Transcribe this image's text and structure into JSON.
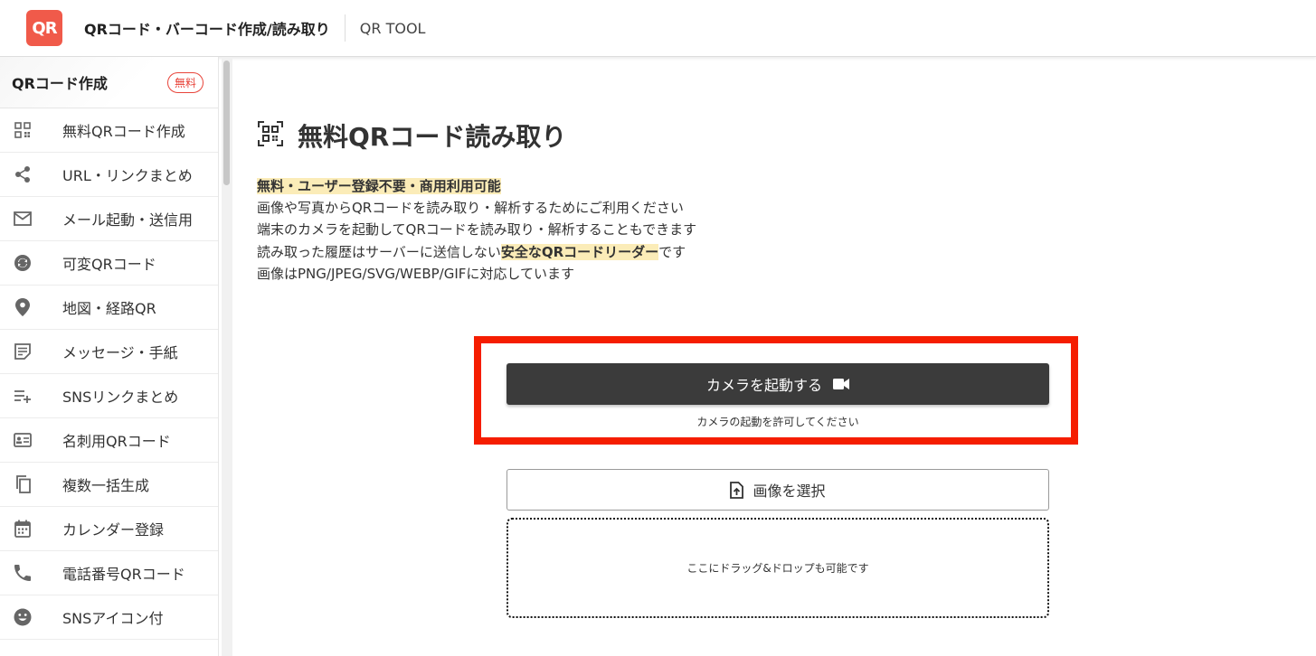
{
  "header": {
    "logo_text": "QR",
    "site_title": "QRコード・バーコード作成/読み取り",
    "sub_title": "QR TOOL"
  },
  "sidebar": {
    "heading": "QRコード作成",
    "badge": "無料",
    "items": [
      {
        "label": "無料QRコード作成",
        "icon": "qr-grid-icon"
      },
      {
        "label": "URL・リンクまとめ",
        "icon": "share-icon"
      },
      {
        "label": "メール起動・送信用",
        "icon": "mail-icon"
      },
      {
        "label": "可変QRコード",
        "icon": "sync-icon"
      },
      {
        "label": "地図・経路QR",
        "icon": "map-pin-icon"
      },
      {
        "label": "メッセージ・手紙",
        "icon": "note-icon"
      },
      {
        "label": "SNSリンクまとめ",
        "icon": "playlist-add-icon"
      },
      {
        "label": "名刺用QRコード",
        "icon": "id-card-icon"
      },
      {
        "label": "複数一括生成",
        "icon": "copy-icon"
      },
      {
        "label": "カレンダー登録",
        "icon": "calendar-icon"
      },
      {
        "label": "電話番号QRコード",
        "icon": "phone-icon"
      },
      {
        "label": "SNSアイコン付",
        "icon": "smiley-icon"
      }
    ]
  },
  "main": {
    "title": "無料QRコード読み取り",
    "desc": {
      "line1": "無料・ユーザー登録不要・商用利用可能",
      "line2": "画像や写真からQRコードを読み取り・解析するためにご利用ください",
      "line3": "端末のカメラを起動してQRコードを読み取り・解析することもできます",
      "line4_pre": "読み取った履歴はサーバーに送信しない",
      "line4_hl": "安全なQRコードリーダー",
      "line4_post": "です",
      "line5": "画像はPNG/JPEG/SVG/WEBP/GIFに対応しています"
    },
    "camera_button": "カメラを起動する",
    "camera_note": "カメラの起動を許可してください",
    "select_button": "画像を選択",
    "drop_text": "ここにドラッグ&ドロップも可能です"
  },
  "colors": {
    "accent_red": "#f51d00",
    "logo": "#f05a4a",
    "highlight": "#fbecb8",
    "dark_button": "#3b3b3b"
  }
}
